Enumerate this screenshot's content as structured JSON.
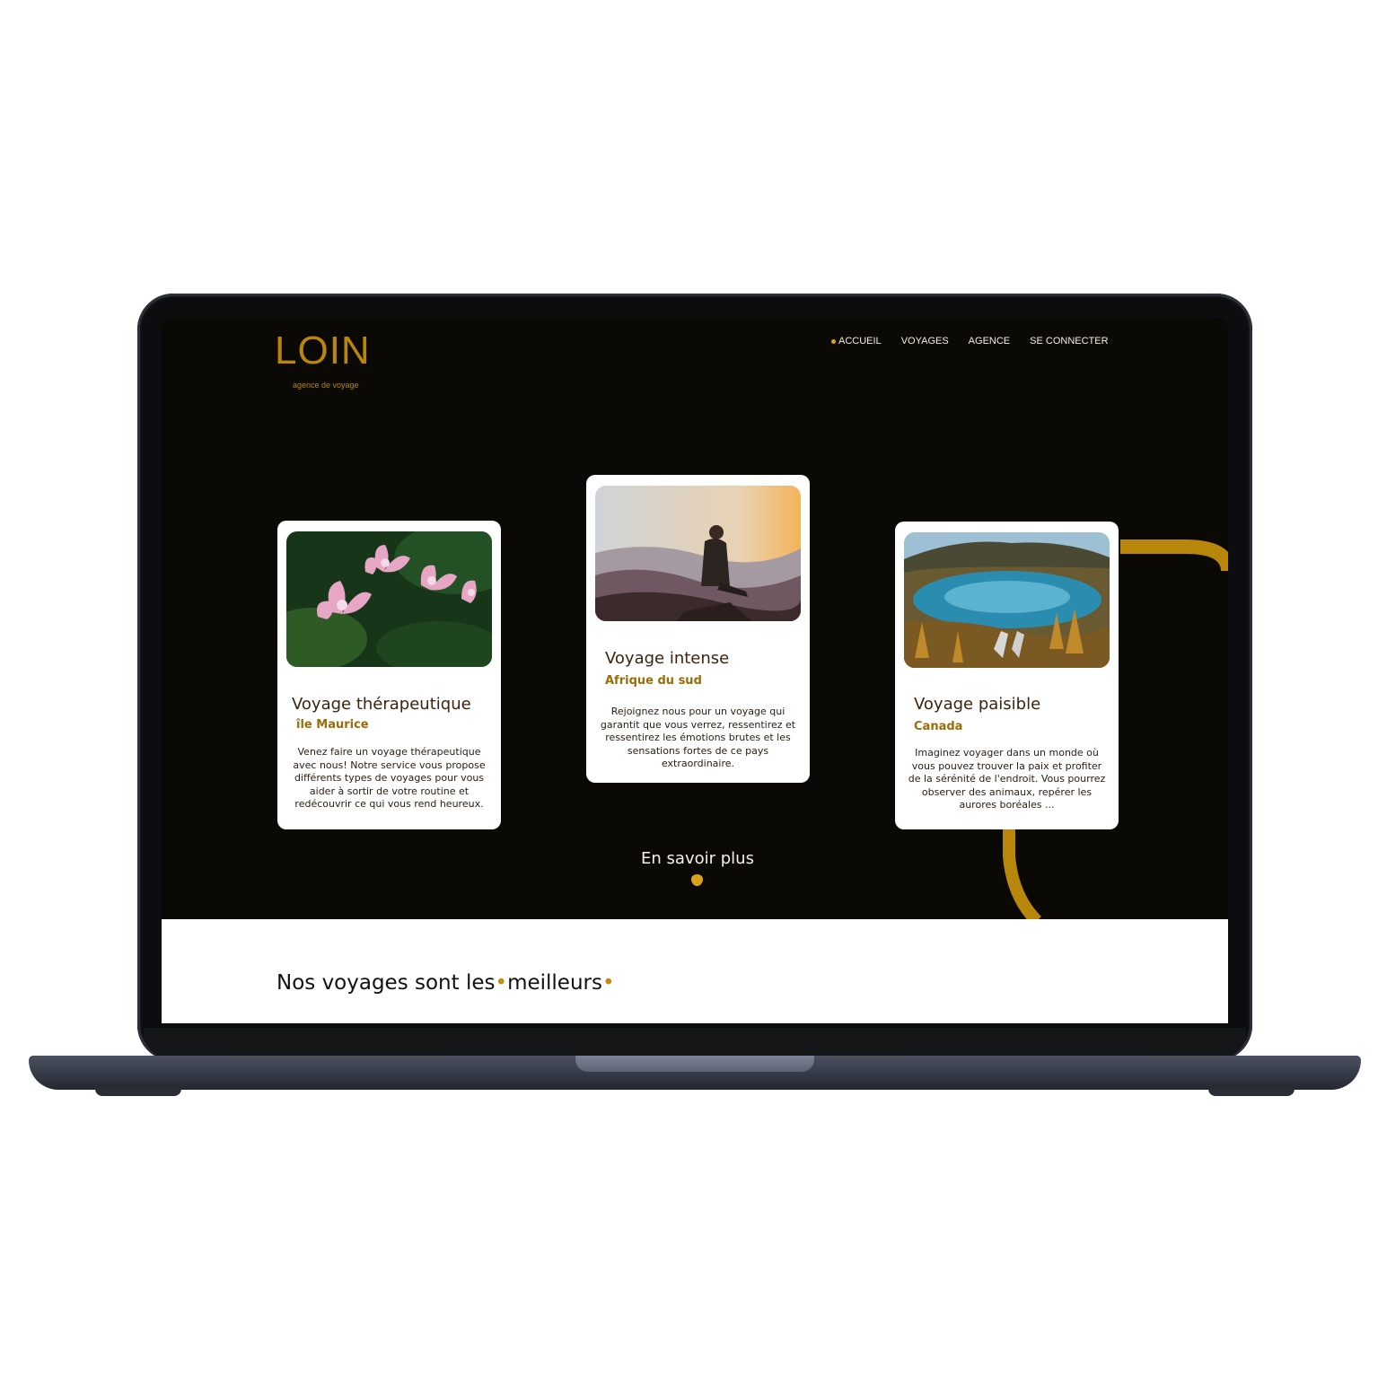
{
  "brand": {
    "logo": "LOIN",
    "tagline": "agence de voyage"
  },
  "nav": {
    "items": [
      "ACCUEIL",
      "VOYAGES",
      "AGENCE",
      "SE CONNECTER"
    ],
    "active": "ACCUEIL"
  },
  "cards": [
    {
      "title": "Voyage thérapeutique",
      "location": "île Maurice",
      "description": "Venez faire un voyage thérapeutique avec nous! Notre service vous propose différents types de voyages pour vous aider à sortir de votre routine et redécouvrir ce qui vous rend heureux."
    },
    {
      "title": "Voyage intense",
      "location": "Afrique du sud",
      "description": "Rejoignez nous pour un voyage qui garantit que vous verrez, ressentirez et ressentirez les émotions brutes et les sensations fortes de ce pays extraordinaire."
    },
    {
      "title": "Voyage paisible",
      "location": "Canada",
      "description": "Imaginez voyager dans un monde où vous pouvez trouver la paix et profiter de la sérénité de l'endroit. Vous pourrez observer des animaux, repérer les aurores boréales ..."
    }
  ],
  "cta": {
    "label": "En savoir plus"
  },
  "section": {
    "title_part1": "Nos voyages sont les",
    "title_part2": "meilleurs"
  },
  "colors": {
    "accent": "#b8860b",
    "background": "#0a0905",
    "text_light": "#f3efe6"
  }
}
